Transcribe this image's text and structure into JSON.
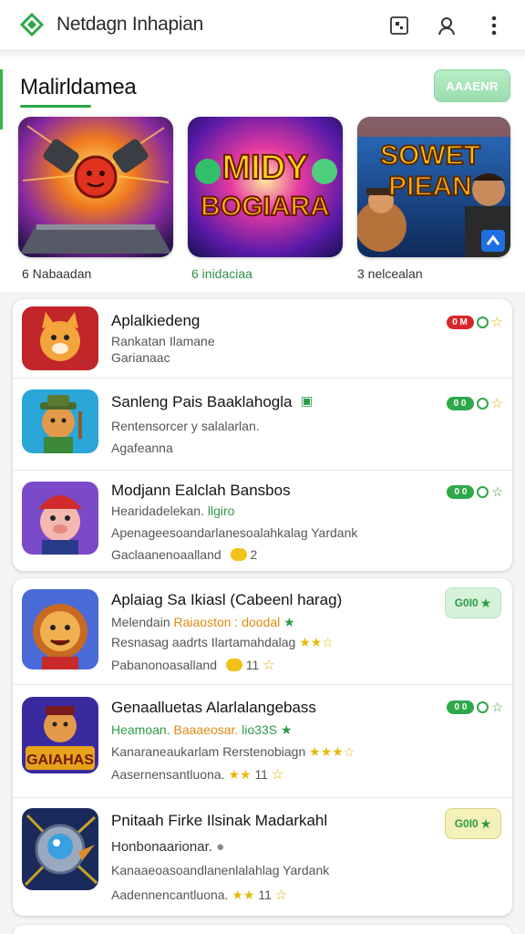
{
  "app": {
    "title": "Netdagn Inhapian"
  },
  "featured": {
    "title": "Malirldamea",
    "action_label": "AAAENR",
    "cards": [
      {
        "caption": "6  Nabaadan",
        "art_text": ""
      },
      {
        "caption": "6 inidaciaa",
        "art_text_1": "MIDY",
        "art_text_2": "BOGIARA"
      },
      {
        "caption": "3 nelcealan",
        "art_text_1": "SOWET",
        "art_text_2": "PIEAN"
      }
    ]
  },
  "list_group_1": [
    {
      "title": "Aplalkiedeng",
      "line1": "Rankatan Ilamane",
      "line2": "Garianaac",
      "badge": "0 M"
    },
    {
      "title": "Sanleng Pais Baaklahogla",
      "line1": "Rentensorcer y salalarlan.",
      "line2": "Agafeanna",
      "badge": "0 0"
    },
    {
      "title": "Modjann Ealclah Bansbos",
      "line1": "Hearidadelekan.",
      "line1_green": "llgiro",
      "line2": "Apenageesoandarlanesoalahkalag Yardank",
      "line3": "Gaclaanenoaalland",
      "count": "2",
      "badge": "0 0"
    }
  ],
  "list_group_2": [
    {
      "title": "Aplaiag Sa Ikiasl (Cabeenl harag)",
      "line1": "Melendain",
      "line1_orange": "Raiaoston : doodal",
      "line2": "Resnasag aadrts Ilartamahdalag",
      "line3": "Pabanonoasalland",
      "count": "11",
      "badge": "G0I0"
    },
    {
      "title": "Genaalluetas Alarlalangebass",
      "line1": "Heamoan.",
      "line1_orange": "Baaaeosar.",
      "line1_green": "lio33S",
      "line2": "Kanaraneaukarlam",
      "line2_b": "Rerstenobiagn",
      "line3": "Aasernensantluona.",
      "count": "11",
      "badge": "0 0"
    },
    {
      "title": "Pnitaah Firke Ilsinak Madarkahl",
      "line1": "Honbonaarionar.",
      "line2": "Kanaaeoasoandlanenlalahlag Yardank",
      "line3": "Aadennencantluona.",
      "count": "11",
      "badge": "G0I0"
    }
  ],
  "colors": {
    "accent": "#29a745",
    "badge_red": "#d9262b",
    "badge_green": "#2ea84a"
  }
}
